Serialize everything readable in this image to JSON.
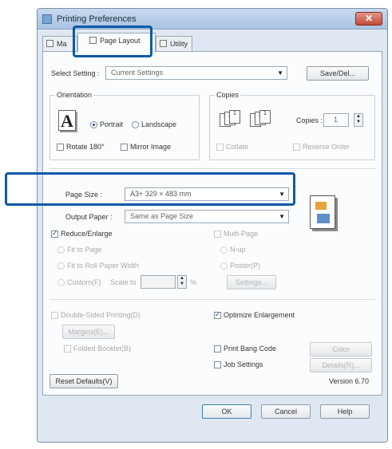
{
  "window": {
    "title": "Printing Preferences",
    "close_glyph": "✕"
  },
  "tabs": [
    {
      "label": "Ma",
      "icon": "main-tab-icon"
    },
    {
      "label": "Page Layout",
      "icon": "page-layout-tab-icon"
    },
    {
      "label": "Utility",
      "icon": "utility-tab-icon"
    }
  ],
  "select_setting": {
    "label": "Select Setting :",
    "value": "Current Settings",
    "save_button": "Save/Del..."
  },
  "orientation": {
    "title": "Orientation",
    "icon_letter": "A",
    "portrait": "Portrait",
    "landscape": "Landscape",
    "selected": "Portrait",
    "rotate": "Rotate 180°",
    "mirror": "Mirror Image"
  },
  "copies": {
    "title": "Copies",
    "label": "Copies :",
    "value": "1",
    "collate": "Collate",
    "reverse": "Reverse Order"
  },
  "page_size": {
    "label": "Page Size :",
    "value": "A3+ 329 × 483 mm"
  },
  "output_paper": {
    "label": "Output Paper :",
    "value": "Same as Page Size"
  },
  "reduce_enlarge": {
    "label": "Reduce/Enlarge",
    "fit_to_page": "Fit to Page",
    "fit_roll": "Fit to Roll Paper Width",
    "custom": "Custom(F)",
    "scale_label": "Scale to",
    "scale_value": "",
    "unit": "%"
  },
  "multi_page": {
    "label": "Multi-Page",
    "n_up": "N-up",
    "poster": "Poster(P)",
    "settings_button": "Settings..."
  },
  "double_sided": {
    "label": "Double-Sided Printing(D)",
    "margins_button": "Margins(E)...",
    "folded_booklet": "Folded Booklet(B)"
  },
  "right_options": {
    "optimize": "Optimize Enlargement",
    "print_bang": "Print Bang Code",
    "color_settings_button": "Color Settings(C)...",
    "job_settings": "Job Settings",
    "details_button": "Details(R)..."
  },
  "footer": {
    "reset_button": "Reset Defaults(V)",
    "version": "Version 6.70",
    "ok": "OK",
    "cancel": "Cancel",
    "help": "Help"
  },
  "colors": {
    "highlight": "#0b5aa6",
    "window_bg": "#dfe8f2"
  }
}
